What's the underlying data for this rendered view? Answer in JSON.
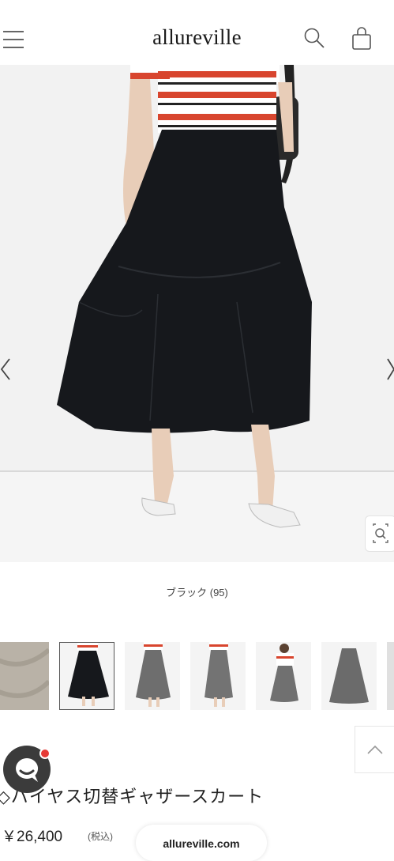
{
  "header": {
    "logo": "allureville"
  },
  "product": {
    "color_label": "ブラック (95)",
    "title": "◇バイヤス切替ギャザースカート",
    "price": "￥26,400",
    "tax_note": "(税込)"
  },
  "browser": {
    "domain": "allureville.com"
  },
  "icons": {
    "menu": "hamburger-menu-icon",
    "search": "search-icon",
    "cart": "shopping-bag-icon",
    "prev": "chevron-left-icon",
    "next": "chevron-right-icon",
    "zoom": "zoom-icon",
    "scroll_top": "chevron-up-icon",
    "chat": "chat-icon"
  },
  "colors": {
    "skirt": "#16181c",
    "stripe_red": "#d8452e",
    "background": "#f2f2f2",
    "notification": "#e53935"
  }
}
